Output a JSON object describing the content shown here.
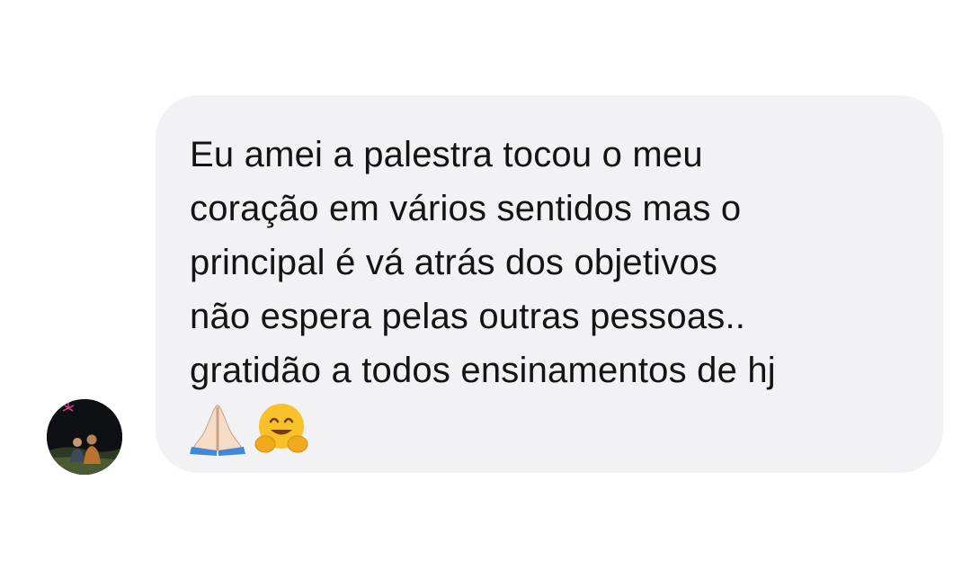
{
  "message": {
    "lines": [
      "Eu amei a palestra tocou o meu",
      "coração em vários sentidos mas o",
      "principal é vá atrás dos objetivos",
      "não espera pelas outras pessoas..",
      "gratidão a todos ensinamentos de hj"
    ],
    "emojis": [
      "folded-hands-icon",
      "hugging-face-icon"
    ]
  },
  "colors": {
    "bubble_background": "#f2f2f4",
    "text": "#141414",
    "page_background": "#ffffff"
  }
}
